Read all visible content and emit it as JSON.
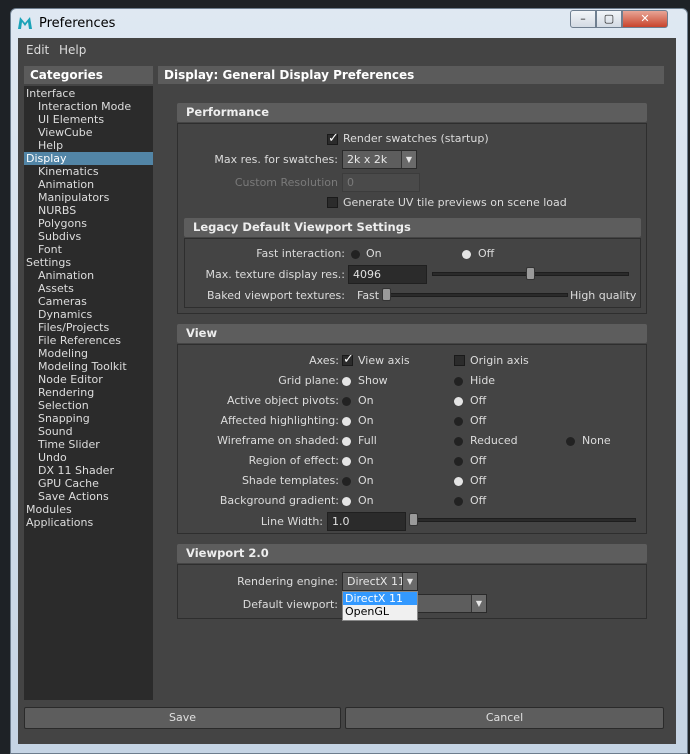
{
  "window": {
    "title": "Preferences",
    "min": "–",
    "max": "▢",
    "close": "✕"
  },
  "menu": [
    "Edit",
    "Help"
  ],
  "categories": {
    "header": "Categories",
    "items": [
      {
        "label": "Interface",
        "level": 0
      },
      {
        "label": "Interaction Mode",
        "level": 1
      },
      {
        "label": "UI Elements",
        "level": 1
      },
      {
        "label": "ViewCube",
        "level": 1
      },
      {
        "label": "Help",
        "level": 1
      },
      {
        "label": "Display",
        "level": 0,
        "selected": true
      },
      {
        "label": "Kinematics",
        "level": 1
      },
      {
        "label": "Animation",
        "level": 1
      },
      {
        "label": "Manipulators",
        "level": 1
      },
      {
        "label": "NURBS",
        "level": 1
      },
      {
        "label": "Polygons",
        "level": 1
      },
      {
        "label": "Subdivs",
        "level": 1
      },
      {
        "label": "Font",
        "level": 1
      },
      {
        "label": "Settings",
        "level": 0
      },
      {
        "label": "Animation",
        "level": 1
      },
      {
        "label": "Assets",
        "level": 1
      },
      {
        "label": "Cameras",
        "level": 1
      },
      {
        "label": "Dynamics",
        "level": 1
      },
      {
        "label": "Files/Projects",
        "level": 1
      },
      {
        "label": "File References",
        "level": 1
      },
      {
        "label": "Modeling",
        "level": 1
      },
      {
        "label": "Modeling Toolkit",
        "level": 1
      },
      {
        "label": "Node Editor",
        "level": 1
      },
      {
        "label": "Rendering",
        "level": 1
      },
      {
        "label": "Selection",
        "level": 1
      },
      {
        "label": "Snapping",
        "level": 1
      },
      {
        "label": "Sound",
        "level": 1
      },
      {
        "label": "Time Slider",
        "level": 1
      },
      {
        "label": "Undo",
        "level": 1
      },
      {
        "label": "DX 11 Shader",
        "level": 1
      },
      {
        "label": "GPU Cache",
        "level": 1
      },
      {
        "label": "Save Actions",
        "level": 1
      },
      {
        "label": "Modules",
        "level": 0
      },
      {
        "label": "Applications",
        "level": 0
      }
    ]
  },
  "page_title": "Display: General Display Preferences",
  "performance": {
    "title": "Performance",
    "render_swatches": "Render swatches (startup)",
    "max_res_label": "Max res. for swatches:",
    "max_res_value": "2k x 2k",
    "custom_res_label": "Custom Resolution",
    "custom_res_value": "0",
    "uv_previews": "Generate UV tile previews on scene load"
  },
  "legacy": {
    "title": "Legacy Default Viewport Settings",
    "fast_label": "Fast interaction:",
    "fast_on": "On",
    "fast_off": "Off",
    "tex_label": "Max. texture display res.:",
    "tex_value": "4096",
    "baked_label": "Baked viewport textures:",
    "baked_fast": "Fast",
    "baked_high": "High quality",
    "tex_slider_fraction": 0.5,
    "baked_slider_fraction": 0.0
  },
  "view": {
    "title": "View",
    "axes_label": "Axes:",
    "axes_view": "View axis",
    "axes_origin": "Origin axis",
    "rows": [
      {
        "label": "Grid plane:",
        "opts": [
          "Show",
          "Hide"
        ],
        "sel": 0
      },
      {
        "label": "Active object pivots:",
        "opts": [
          "On",
          "Off"
        ],
        "sel": 1
      },
      {
        "label": "Affected highlighting:",
        "opts": [
          "On",
          "Off"
        ],
        "sel": 0
      },
      {
        "label": "Wireframe on shaded:",
        "opts": [
          "Full",
          "Reduced",
          "None"
        ],
        "sel": 0
      },
      {
        "label": "Region of effect:",
        "opts": [
          "On",
          "Off"
        ],
        "sel": 0
      },
      {
        "label": "Shade templates:",
        "opts": [
          "On",
          "Off"
        ],
        "sel": 1
      },
      {
        "label": "Background gradient:",
        "opts": [
          "On",
          "Off"
        ],
        "sel": 0
      }
    ],
    "line_width_label": "Line Width:",
    "line_width_value": "1.0",
    "line_width_fraction": 0.0
  },
  "viewport2": {
    "title": "Viewport 2.0",
    "engine_label": "Rendering engine:",
    "engine_value": "DirectX 11",
    "default_label": "Default viewport:",
    "dropdown": [
      "DirectX 11",
      "OpenGL"
    ]
  },
  "buttons": {
    "save": "Save",
    "cancel": "Cancel"
  }
}
